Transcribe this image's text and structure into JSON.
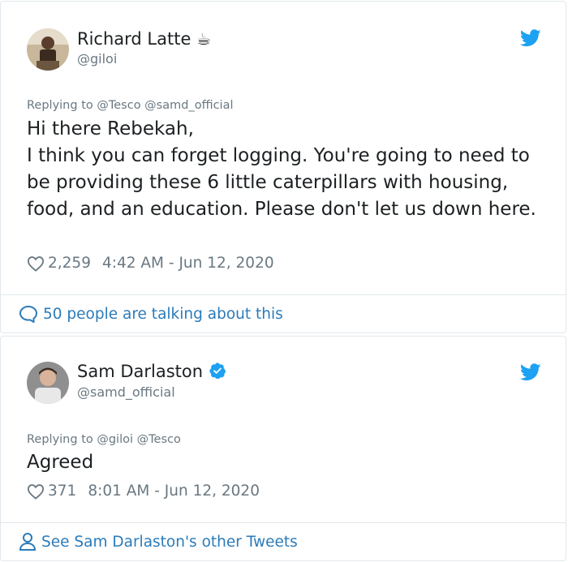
{
  "tweets": [
    {
      "author_name": "Richard Latte",
      "author_emoji": "☕",
      "author_handle": "@giloi",
      "replying_to": "Replying to @Tesco @samd_official",
      "text": "Hi there Rebekah,\nI think you can forget logging. You're going to need to be providing these 6 little caterpillars with housing, food, and an education. Please don't let us down here.",
      "likes": "2,259",
      "timestamp": "4:42 AM - Jun 12, 2020",
      "footer_link": "50 people are talking about this",
      "footer_icon": "speech-bubble-icon",
      "verified": false
    },
    {
      "author_name": "Sam Darlaston",
      "author_handle": "@samd_official",
      "replying_to": "Replying to @giloi @Tesco",
      "text": "Agreed",
      "likes": "371",
      "timestamp": "8:01 AM - Jun 12, 2020",
      "footer_link": "See Sam Darlaston's other Tweets",
      "footer_icon": "person-icon",
      "verified": true
    }
  ],
  "colors": {
    "twitter_blue": "#1da1f2",
    "link_blue": "#2b7bb9",
    "muted_text": "#697882",
    "border": "#e1e8ed"
  }
}
